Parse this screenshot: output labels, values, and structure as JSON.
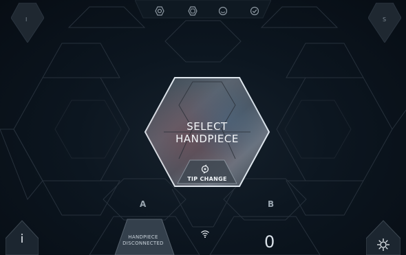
{
  "screen": {
    "main_prompt": "SELECT\nHANDPIECE",
    "main_prompt_line1": "SELECT",
    "main_prompt_line2": "HANDPIECE",
    "tip_change_label": "TIP CHANGE",
    "tip_change_icon": "tip-change-icon"
  },
  "corners": {
    "top_left_label": "I",
    "top_right_label": "S"
  },
  "status_bar": {
    "icons": [
      "hex-ring-icon",
      "hex-outline-icon",
      "circle-drop-icon",
      "check-circle-icon"
    ]
  },
  "slots": {
    "a": {
      "letter": "A",
      "status_line1": "HANDPIECE",
      "status_line2": "DISCONNECTED"
    },
    "b": {
      "letter": "B",
      "value": "0"
    }
  },
  "bottom_bar": {
    "info_label": "i",
    "info_icon": "info-icon",
    "wifi_icon": "wifi-icon",
    "settings_icon": "gear-icon"
  },
  "colors": {
    "background": "#0c1620",
    "grid_line": "#2a3440",
    "accent_border": "#d7e0e8",
    "text_primary": "#f4f7fa",
    "text_muted": "#7e8a95"
  }
}
